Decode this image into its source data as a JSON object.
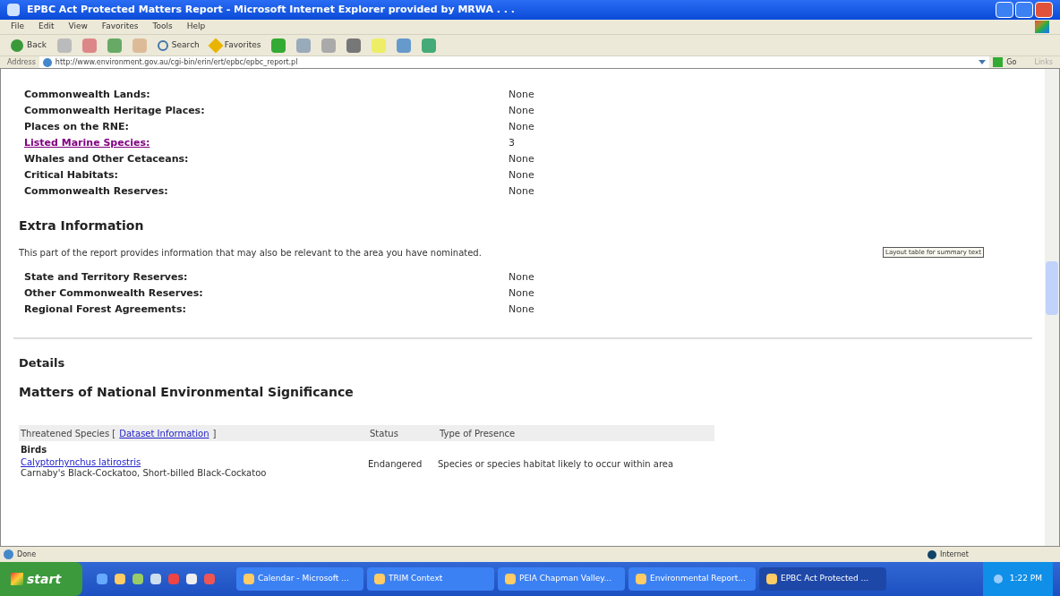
{
  "window": {
    "title": "EPBC Act Protected Matters Report - Microsoft Internet Explorer provided by MRWA . . ."
  },
  "menu": [
    "File",
    "Edit",
    "View",
    "Favorites",
    "Tools",
    "Help"
  ],
  "toolbar": {
    "back": "Back",
    "search": "Search",
    "favorites": "Favorites"
  },
  "address": {
    "label": "Address",
    "value": "http://www.environment.gov.au/cgi-bin/erin/ert/epbc/epbc_report.pl",
    "go": "Go",
    "links": "Links"
  },
  "summary": [
    {
      "label": "Commonwealth Lands:",
      "value": "None",
      "link": false
    },
    {
      "label": "Commonwealth Heritage Places:",
      "value": "None",
      "link": false
    },
    {
      "label": "Places on the RNE:",
      "value": "None",
      "link": false
    },
    {
      "label": "Listed Marine Species:",
      "value": "3",
      "link": true
    },
    {
      "label": "Whales and Other Cetaceans:",
      "value": "None",
      "link": false
    },
    {
      "label": "Critical Habitats:",
      "value": "None",
      "link": false
    },
    {
      "label": "Commonwealth Reserves:",
      "value": "None",
      "link": false
    }
  ],
  "extra": {
    "heading": "Extra Information",
    "text": "This part of the report provides information that may also be relevant to the area you have nominated.",
    "tooltip": "Layout table for summary text",
    "rows": [
      {
        "label": "State and Territory Reserves:",
        "value": "None",
        "link": false
      },
      {
        "label": "Other Commonwealth Reserves:",
        "value": "None",
        "link": false
      },
      {
        "label": "Regional Forest Agreements:",
        "value": "None",
        "link": false
      }
    ]
  },
  "details": {
    "heading": "Details",
    "subheading": "Matters of National Environmental Significance",
    "table": {
      "column_1": "Threatened Species [",
      "dataset_link": "Dataset Information",
      "column_1_end": "]",
      "status": "Status",
      "presence": "Type of Presence",
      "group": "Birds",
      "rows": [
        {
          "species": "Calyptorhynchus latirostris",
          "common": "Carnaby's Black-Cockatoo, Short-billed Black-Cockatoo",
          "status": "Endangered",
          "presence": "Species or species habitat likely to occur within area"
        }
      ]
    }
  },
  "status_bar": {
    "text": "Done",
    "zone": "Internet"
  },
  "taskbar": {
    "start": "start",
    "tasks": [
      {
        "label": "Calendar - Microsoft ...",
        "selected": false
      },
      {
        "label": "TRIM Context",
        "selected": false
      },
      {
        "label": "PEIA Chapman Valley...",
        "selected": false
      },
      {
        "label": "Environmental Report...",
        "selected": false
      },
      {
        "label": "EPBC Act Protected ...",
        "selected": true
      }
    ],
    "clock": "1:22 PM"
  }
}
